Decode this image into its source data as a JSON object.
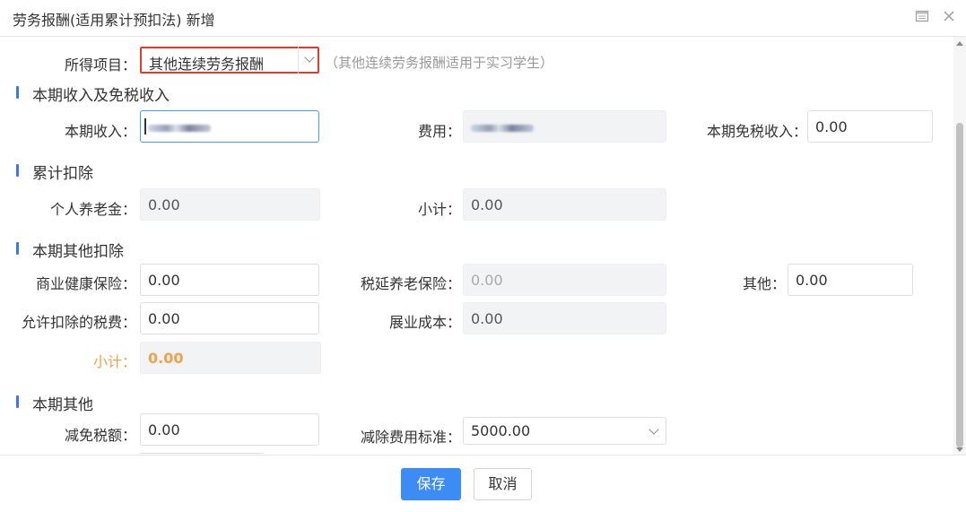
{
  "dialog": {
    "title": "劳务报酬(适用累计预扣法) 新增"
  },
  "income_item": {
    "label": "所得项目：",
    "value": "其他连续劳务报酬",
    "hint": "（其他连续劳务报酬适用于实习学生）"
  },
  "sections": {
    "current_income": "本期收入及免税收入",
    "cumulative_deduction": "累计扣除",
    "other_deduction": "本期其他扣除",
    "other": "本期其他"
  },
  "current_income": {
    "income_label": "本期收入：",
    "expense_label": "费用：",
    "exempt_label": "本期免税收入：",
    "exempt_value": "0.00"
  },
  "cumulative": {
    "pension_label": "个人养老金：",
    "pension_value": "0.00",
    "subtotal_label": "小计：",
    "subtotal_value": "0.00"
  },
  "other_deduction": {
    "health_label": "商业健康保险：",
    "health_value": "0.00",
    "tax_deferred_label": "税延养老保险：",
    "tax_deferred_value": "0.00",
    "other_label": "其他：",
    "other_value": "0.00",
    "allowed_tax_label": "允许扣除的税费：",
    "allowed_tax_value": "0.00",
    "exhibition_label": "展业成本：",
    "exhibition_value": "0.00",
    "subtotal_label": "小计：",
    "subtotal_value": "0.00"
  },
  "other": {
    "reduction_label": "减免税额：",
    "reduction_value": "0.00",
    "standard_label": "减除费用标准：",
    "standard_value": "5000.00"
  },
  "footer": {
    "save_label": "保存",
    "cancel_label": "取消"
  },
  "colors": {
    "primary": "#3d8cf5",
    "highlight_border": "#e23b2e",
    "subtotal_orange": "#f0a24b"
  }
}
